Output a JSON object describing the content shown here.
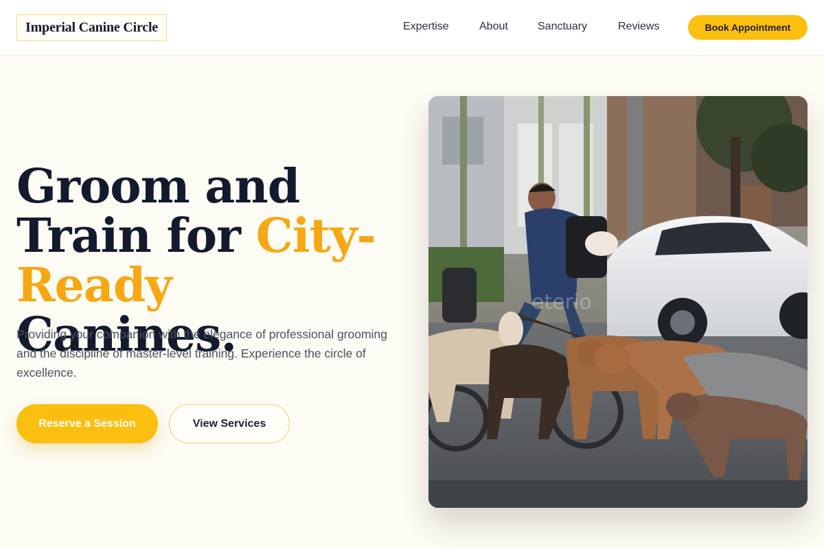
{
  "header": {
    "logo": "Imperial Canine Circle",
    "nav": [
      "Expertise",
      "About",
      "Sanctuary",
      "Reviews"
    ],
    "cta": "Book Appointment"
  },
  "hero": {
    "headline_part1": "Groom and Train for ",
    "headline_accent1": "City-",
    "headline_accent2": "Ready",
    "headline_part2": " Canines.",
    "description": "Providing your companion with the elegance of professional grooming and the discipline of master-level training. Experience the circle of excellence.",
    "primary_button": "Reserve a Session",
    "secondary_button": "View Services"
  },
  "photo": {
    "description_icon": "dog-walker-photo"
  },
  "colors": {
    "accent": "#fbbf10",
    "accent_text": "#f7a712",
    "background": "#fcfbf4",
    "ink": "#141a2e"
  }
}
